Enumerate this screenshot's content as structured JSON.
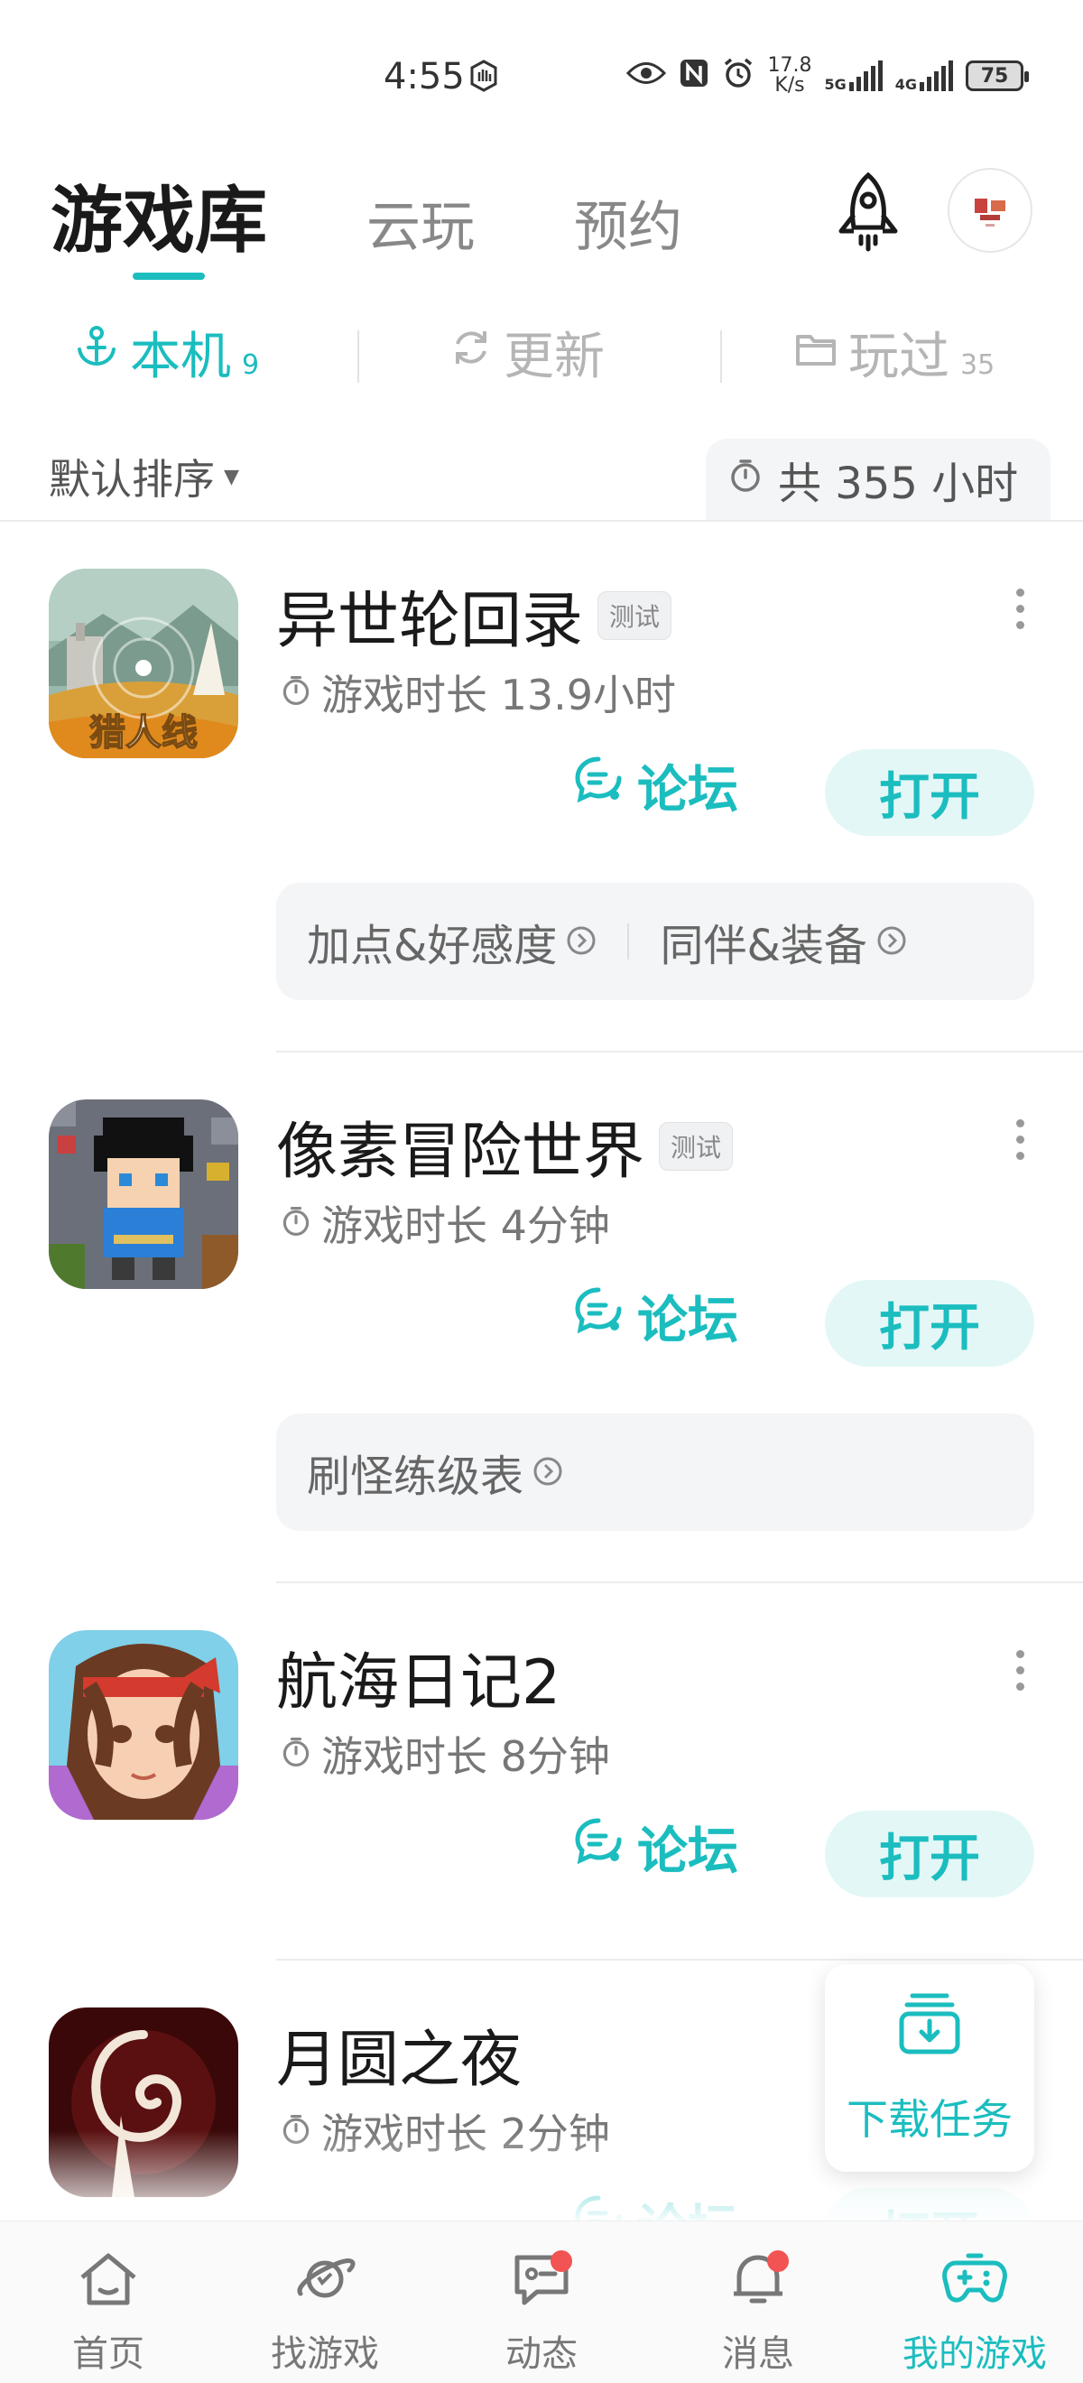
{
  "status_bar": {
    "time": "4:55",
    "speed_value": "17.8",
    "speed_unit": "K/s",
    "net1": "5G",
    "net2": "4G",
    "battery": "75"
  },
  "top_tabs": [
    {
      "label": "游戏库",
      "active": true
    },
    {
      "label": "云玩",
      "active": false
    },
    {
      "label": "预约",
      "active": false
    }
  ],
  "sub_tabs": [
    {
      "label": "本机",
      "count": "9",
      "icon": "anchor-icon",
      "active": true
    },
    {
      "label": "更新",
      "count": "",
      "icon": "refresh-icon",
      "active": false
    },
    {
      "label": "玩过",
      "count": "35",
      "icon": "folder-icon",
      "active": false
    }
  ],
  "sort": {
    "label": "默认排序"
  },
  "total": {
    "label": "共 355 小时"
  },
  "games": [
    {
      "name": "异世轮回录",
      "tag": "测试",
      "playtime": "游戏时长 13.9小时",
      "icon_text": "猎人线",
      "guides": [
        "加点&好感度",
        "同伴&装备"
      ]
    },
    {
      "name": "像素冒险世界",
      "tag": "测试",
      "playtime": "游戏时长 4分钟",
      "guides": [
        "刷怪练级表"
      ]
    },
    {
      "name": "航海日记2",
      "tag": "",
      "playtime": "游戏时长 8分钟",
      "guides": []
    },
    {
      "name": "月圆之夜",
      "tag": "",
      "playtime": "游戏时长 2分钟",
      "guides": []
    }
  ],
  "actions": {
    "forum": "论坛",
    "open": "打开"
  },
  "download_task": {
    "label": "下载任务"
  },
  "bottom_nav": [
    {
      "label": "首页",
      "icon": "home-icon",
      "badge": false,
      "active": false
    },
    {
      "label": "找游戏",
      "icon": "planet-icon",
      "badge": false,
      "active": false
    },
    {
      "label": "动态",
      "icon": "chat-icon",
      "badge": true,
      "active": false
    },
    {
      "label": "消息",
      "icon": "bell-icon",
      "badge": true,
      "active": false
    },
    {
      "label": "我的游戏",
      "icon": "gamepad-icon",
      "badge": false,
      "active": true
    }
  ],
  "colors": {
    "accent": "#1bbdbf",
    "badge": "#f25353"
  }
}
